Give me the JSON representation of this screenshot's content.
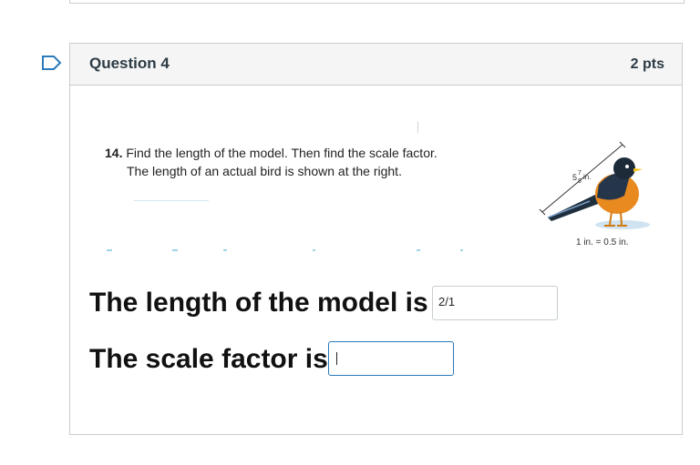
{
  "question": {
    "title": "Question 4",
    "points": "2 pts"
  },
  "problem": {
    "number": "14.",
    "line1": "Find the length of the model. Then find the scale factor.",
    "line2": "The length of an actual bird is shown at the right."
  },
  "figure": {
    "length_whole": "5",
    "length_num": "7",
    "length_den": "8",
    "length_unit": "in.",
    "scale_note": "1 in. = 0.5 in.",
    "icon": "robin-bird-illustration"
  },
  "answers": {
    "length_label": "The length of the model is",
    "length_value": "2/1",
    "scale_label": "The scale factor is",
    "scale_value": ""
  },
  "colors": {
    "accent": "#2b7abc",
    "header_bg": "#f5f5f5",
    "border": "#c7cdd1"
  }
}
